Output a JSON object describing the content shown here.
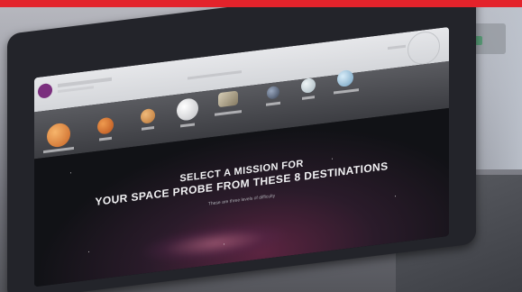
{
  "top_bar": {
    "text": "",
    "color": "#e3232b"
  },
  "screen": {
    "headline_line1": "SELECT A MISSION FOR",
    "headline_line2": "YOUR SPACE PROBE FROM THESE 8 DESTINATIONS",
    "subline": "These are three levels of difficulty",
    "destinations": [
      {
        "name": "",
        "color": "#e78a3b"
      },
      {
        "name": "",
        "color": "#d2702c"
      },
      {
        "name": "",
        "color": "#d79a56"
      },
      {
        "name": "",
        "color": "#e6e6e8"
      },
      {
        "name": "",
        "color": "#b7a98f"
      },
      {
        "name": "",
        "color": "#5f6f88"
      },
      {
        "name": "",
        "color": "#cfd8dc"
      },
      {
        "name": "",
        "color": "#a6c7de"
      }
    ]
  },
  "colors": {
    "bezel": "#23242a",
    "header": "#e0e1e4",
    "badge": "#7b2f7e"
  }
}
